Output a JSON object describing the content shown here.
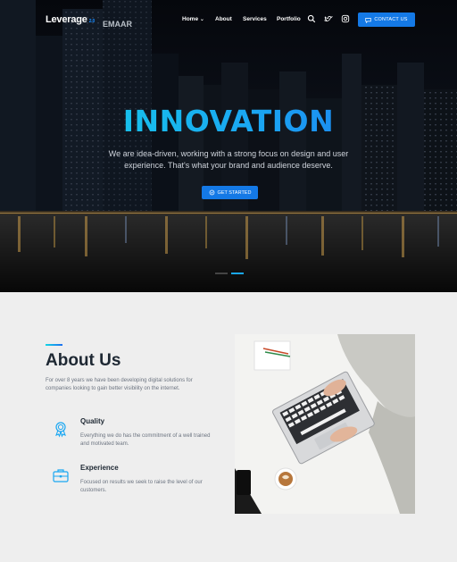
{
  "nav": {
    "logo": "Leverage",
    "logo_version": "2.0",
    "links": [
      "Home",
      "About",
      "Services",
      "Portfolio"
    ],
    "contact_label": "CONTACT US"
  },
  "hero": {
    "title": "INNOVATION",
    "subtitle": "We are idea-driven, working with a strong focus on design and user experience. That's what your brand and audience deserve.",
    "cta_label": "GET STARTED",
    "building_sign": "EMAAR",
    "slides": 2,
    "active_slide": 2
  },
  "about": {
    "title": "About Us",
    "description": "For over 8 years we have been developing digital solutions for companies looking to gain better visibility on the internet.",
    "features": [
      {
        "icon": "award-icon",
        "title": "Quality",
        "text": "Everything we do has the commitment of a well trained and motivated team."
      },
      {
        "icon": "briefcase-icon",
        "title": "Experience",
        "text": "Focused on results we seek to raise the level of our customers."
      }
    ]
  },
  "colors": {
    "accent": "#1479e6",
    "gradient_start": "#14d6e6",
    "gradient_end": "#1d6ef0",
    "heading": "#1e2833"
  }
}
